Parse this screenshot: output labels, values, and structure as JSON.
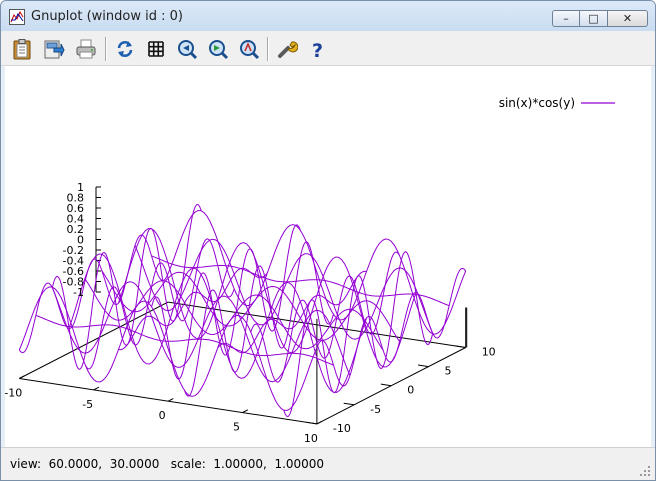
{
  "window": {
    "title": "Gnuplot (window id : 0)",
    "minimize_glyph": "–",
    "maximize_glyph": "□",
    "close_glyph": "✕"
  },
  "toolbar": {
    "buttons": [
      {
        "name": "copy-clipboard-icon"
      },
      {
        "name": "save-icon"
      },
      {
        "name": "print-icon"
      },
      {
        "name": "replot-icon"
      },
      {
        "name": "grid-icon"
      },
      {
        "name": "zoom-previous-icon"
      },
      {
        "name": "zoom-next-icon"
      },
      {
        "name": "zoom-unzoom-icon"
      },
      {
        "name": "options-wrench-icon"
      },
      {
        "name": "help-icon"
      }
    ]
  },
  "status": {
    "text": "view:  60.0000,  30.0000   scale:  1.00000,  1.00000"
  },
  "chart_data": {
    "type": "surface-lines",
    "function": "sin(x)*cos(y)",
    "legend": [
      {
        "name": "sin(x)*cos(y)",
        "color": "#9400d3",
        "position": "top-right"
      }
    ],
    "view": {
      "rot_x": 60,
      "rot_z": 30,
      "scale": 1,
      "scale_z": 1
    },
    "x_range": [
      -10,
      10
    ],
    "y_range": [
      -10,
      10
    ],
    "z_range": [
      -1,
      1
    ],
    "x_ticks": [
      "-10",
      "-5",
      "0",
      "5",
      "10"
    ],
    "y_ticks": [
      "-10",
      "-5",
      "0",
      "5",
      "10"
    ],
    "z_ticks": [
      "1",
      "0.8",
      "0.6",
      "0.4",
      "0.2",
      "0",
      "-0.2",
      "-0.4",
      "-0.6",
      "-0.8",
      "-1"
    ],
    "isosamples": 10,
    "samples": 100,
    "line_color": "#9400d3"
  }
}
